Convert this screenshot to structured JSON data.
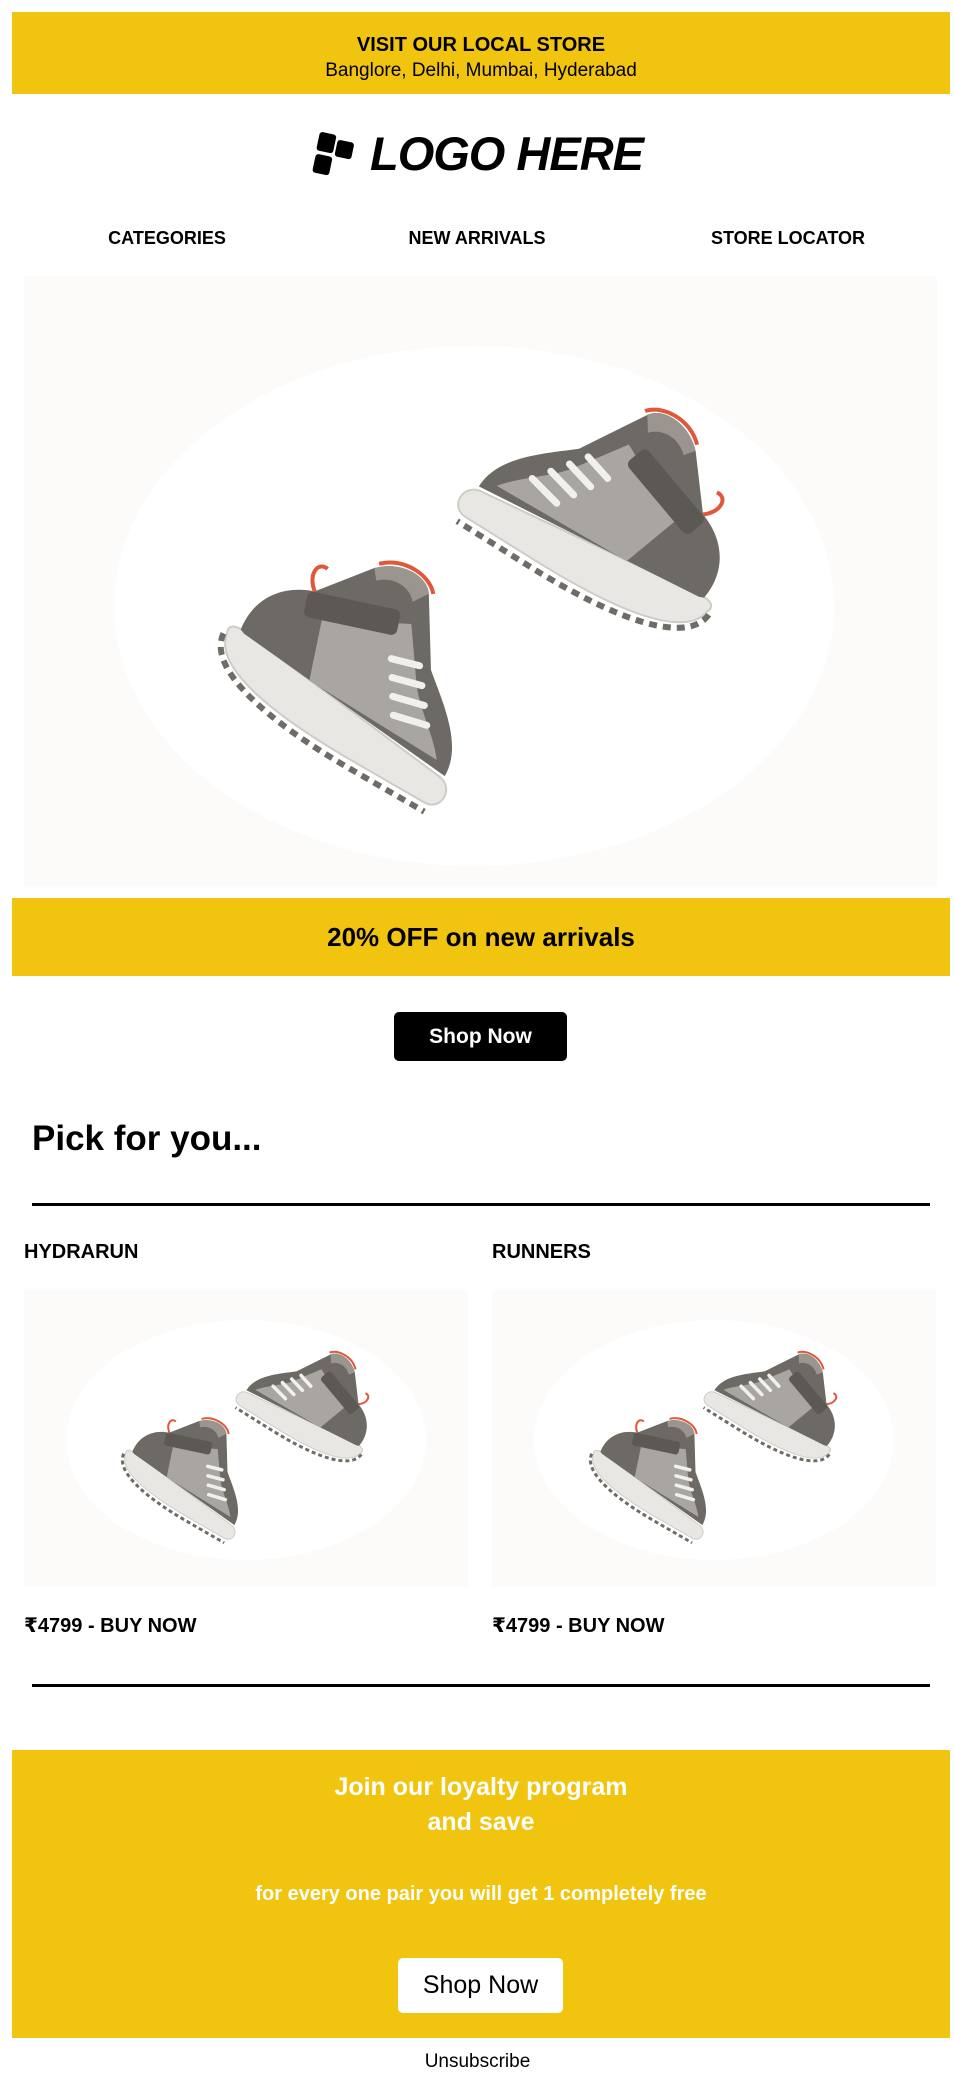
{
  "colors": {
    "accent": "#f1c40f",
    "text": "#000000",
    "button_dark": "#000000",
    "button_light": "#ffffff"
  },
  "top_banner": {
    "title": "VISIT OUR LOCAL STORE",
    "cities": "Banglore, Delhi, Mumbai, Hyderabad"
  },
  "logo": {
    "text": "LOGO HERE",
    "icon": "logo-mark-icon"
  },
  "nav": [
    {
      "label": "CATEGORIES"
    },
    {
      "label": "NEW ARRIVALS"
    },
    {
      "label": "STORE LOCATOR"
    }
  ],
  "hero": {
    "image": "sneakers-photo"
  },
  "promo": {
    "text": "20% OFF on new arrivals"
  },
  "cta": {
    "label": "Shop Now"
  },
  "picks": {
    "title": "Pick for you...",
    "products": [
      {
        "name": "HYDRARUN",
        "price_label": "₹4799 - BUY NOW"
      },
      {
        "name": "RUNNERS",
        "price_label": "₹4799 - BUY NOW"
      }
    ]
  },
  "loyalty": {
    "headline_line1": "Join our loyalty program",
    "headline_line2": "and save",
    "subtext": "for every one pair you will get 1 completely free",
    "button_label": "Shop Now"
  },
  "footer": {
    "unsubscribe": "Unsubscribe"
  }
}
